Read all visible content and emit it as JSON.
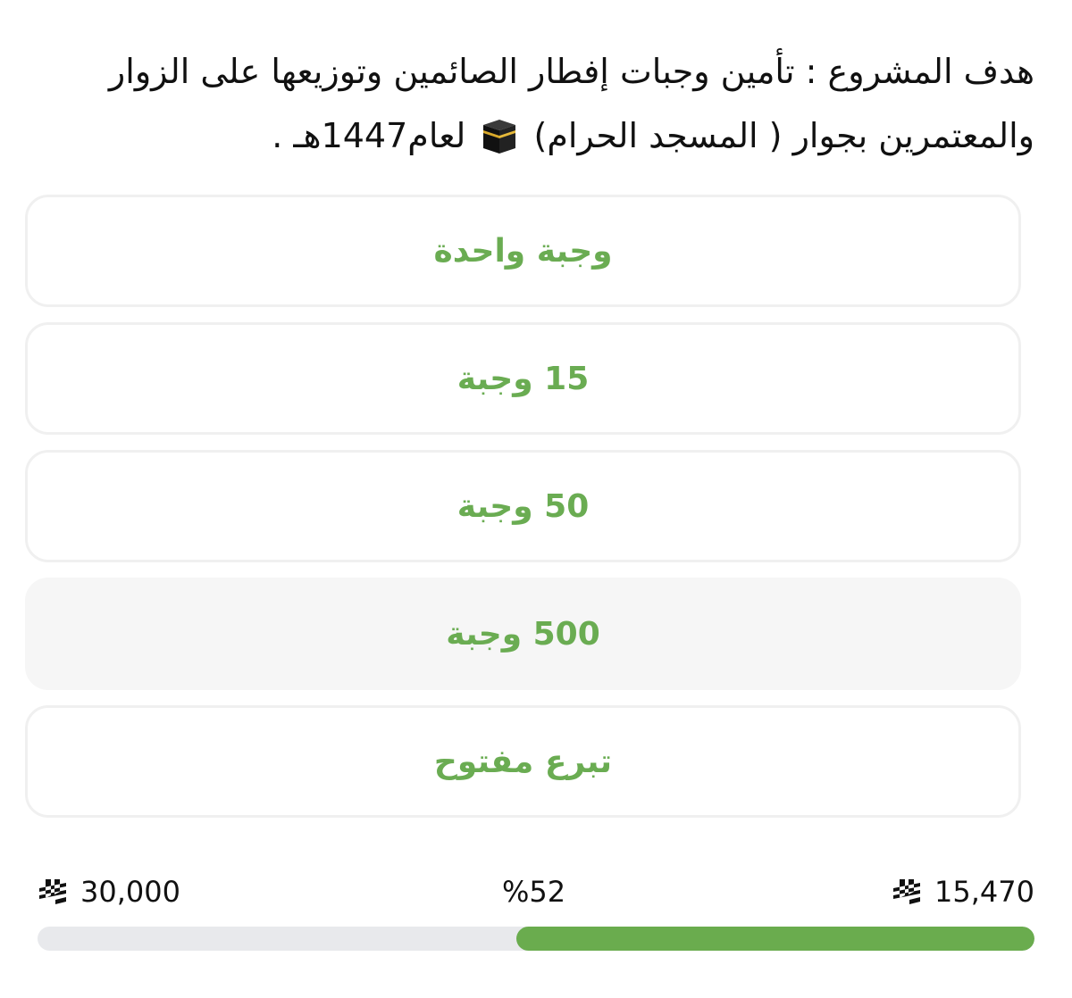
{
  "project": {
    "description_before_icon": "هدف المشروع : تأمين وجبات إفطار الصائمين وتوزيعها على الزوار والمعتمرين بجوار ( المسجد الحرام)",
    "kaaba_icon": "kaaba-emoji",
    "description_after_icon": "لعام1447هـ ."
  },
  "donation_options": [
    {
      "label": "وجبة واحدة",
      "selected": false
    },
    {
      "label": "15 وجبة",
      "selected": false
    },
    {
      "label": "50 وجبة",
      "selected": false
    },
    {
      "label": "500 وجبة",
      "selected": true
    },
    {
      "label": "تبرع مفتوح",
      "selected": false
    }
  ],
  "progress": {
    "collected": "15,470",
    "target": "30,000",
    "percent_label": "%52",
    "percent_value": 52,
    "currency_icon": "saudi-riyal-icon"
  },
  "colors": {
    "accent_green": "#6aac52",
    "progress_fill": "#6aac4e",
    "progress_track": "#e8e9ec",
    "option_border": "#f0f0f0",
    "selected_background": "#f6f6f6"
  }
}
